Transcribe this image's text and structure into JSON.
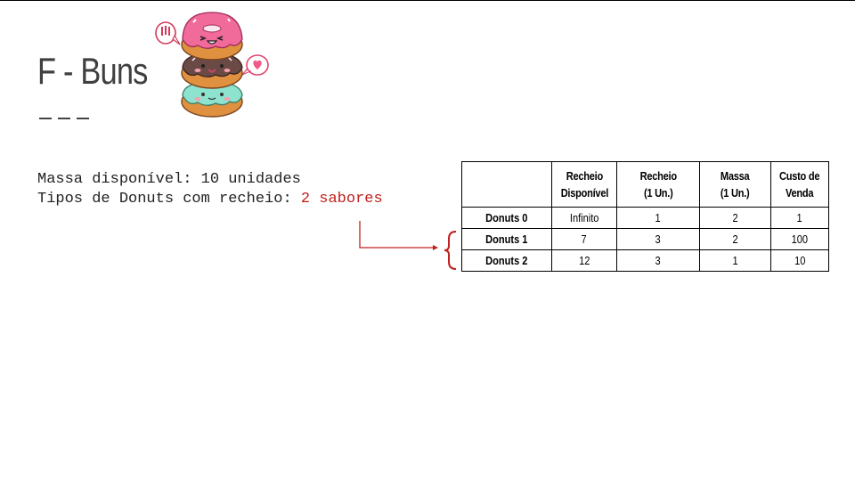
{
  "slide": {
    "title": "F - Buns",
    "info_line1": "Massa disponível: 10 unidades",
    "info_line2_prefix": "Tipos de Donuts com recheio: ",
    "info_line2_highlight": "2 sabores",
    "accent_color": "#c0201e"
  },
  "table": {
    "headers": [
      {
        "line1": "",
        "line2": ""
      },
      {
        "line1": "Recheio",
        "line2": "Disponível"
      },
      {
        "line1": "Recheio",
        "line2": "(1 Un.)"
      },
      {
        "line1": "Massa",
        "line2": "(1 Un.)"
      },
      {
        "line1": "Custo de",
        "line2": "Venda"
      }
    ],
    "rows": [
      {
        "name": "Donuts 0",
        "recheio_disponivel": "Infinito",
        "recheio_un": "1",
        "massa_un": "2",
        "custo_venda": "1"
      },
      {
        "name": "Donuts 1",
        "recheio_disponivel": "7",
        "recheio_un": "3",
        "massa_un": "2",
        "custo_venda": "100"
      },
      {
        "name": "Donuts 2",
        "recheio_disponivel": "12",
        "recheio_un": "3",
        "massa_un": "1",
        "custo_venda": "10"
      }
    ]
  },
  "illustration": {
    "icon": "stacked-donuts-icon"
  }
}
